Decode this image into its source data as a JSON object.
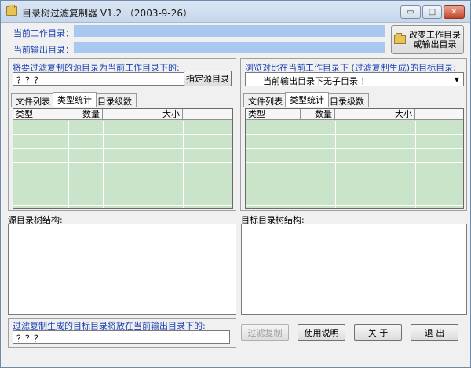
{
  "window": {
    "title": "目录树过滤复制器 V1.2 （2003-9-26）",
    "min_glyph": "▭",
    "max_glyph": "□",
    "close_glyph": "✕"
  },
  "paths": {
    "work_dir_label": "当前工作目录：",
    "work_dir_value": "",
    "output_dir_label": "当前输出目录：",
    "output_dir_value": "",
    "change_button": "改变工作目录\n或输出目录"
  },
  "source": {
    "prompt_label": "将要过滤复制的源目录为当前工作目录下的:",
    "input_value": "？？？",
    "specify_button": "指定源目录",
    "tabs": [
      "文件列表",
      "类型统计",
      "目录级数"
    ],
    "active_tab": 1,
    "columns": [
      "类型",
      "数量",
      "大小"
    ],
    "tree_label": "源目录树结构:"
  },
  "target": {
    "browse_label": "浏览对比在当前工作目录下 (过滤复制生成)的目标目录:",
    "select_value": "当前输出目录下无子目录 ！",
    "tabs": [
      "文件列表",
      "类型统计",
      "目录级数"
    ],
    "active_tab": 1,
    "columns": [
      "类型",
      "数量",
      "大小"
    ],
    "tree_label": "目标目录树结构:"
  },
  "bottom": {
    "place_label": "过滤复制生成的目标目录将放在当前输出目录下的:",
    "input_value": "？？？",
    "filter_copy_button": "过滤复制",
    "help_button": "使用说明",
    "about_button": "关 于",
    "exit_button": "退 出"
  },
  "colors": {
    "label_blue": "#1a3fb4",
    "path_bar": "#a9c8f0",
    "grid_green": "#c9e4c9"
  }
}
